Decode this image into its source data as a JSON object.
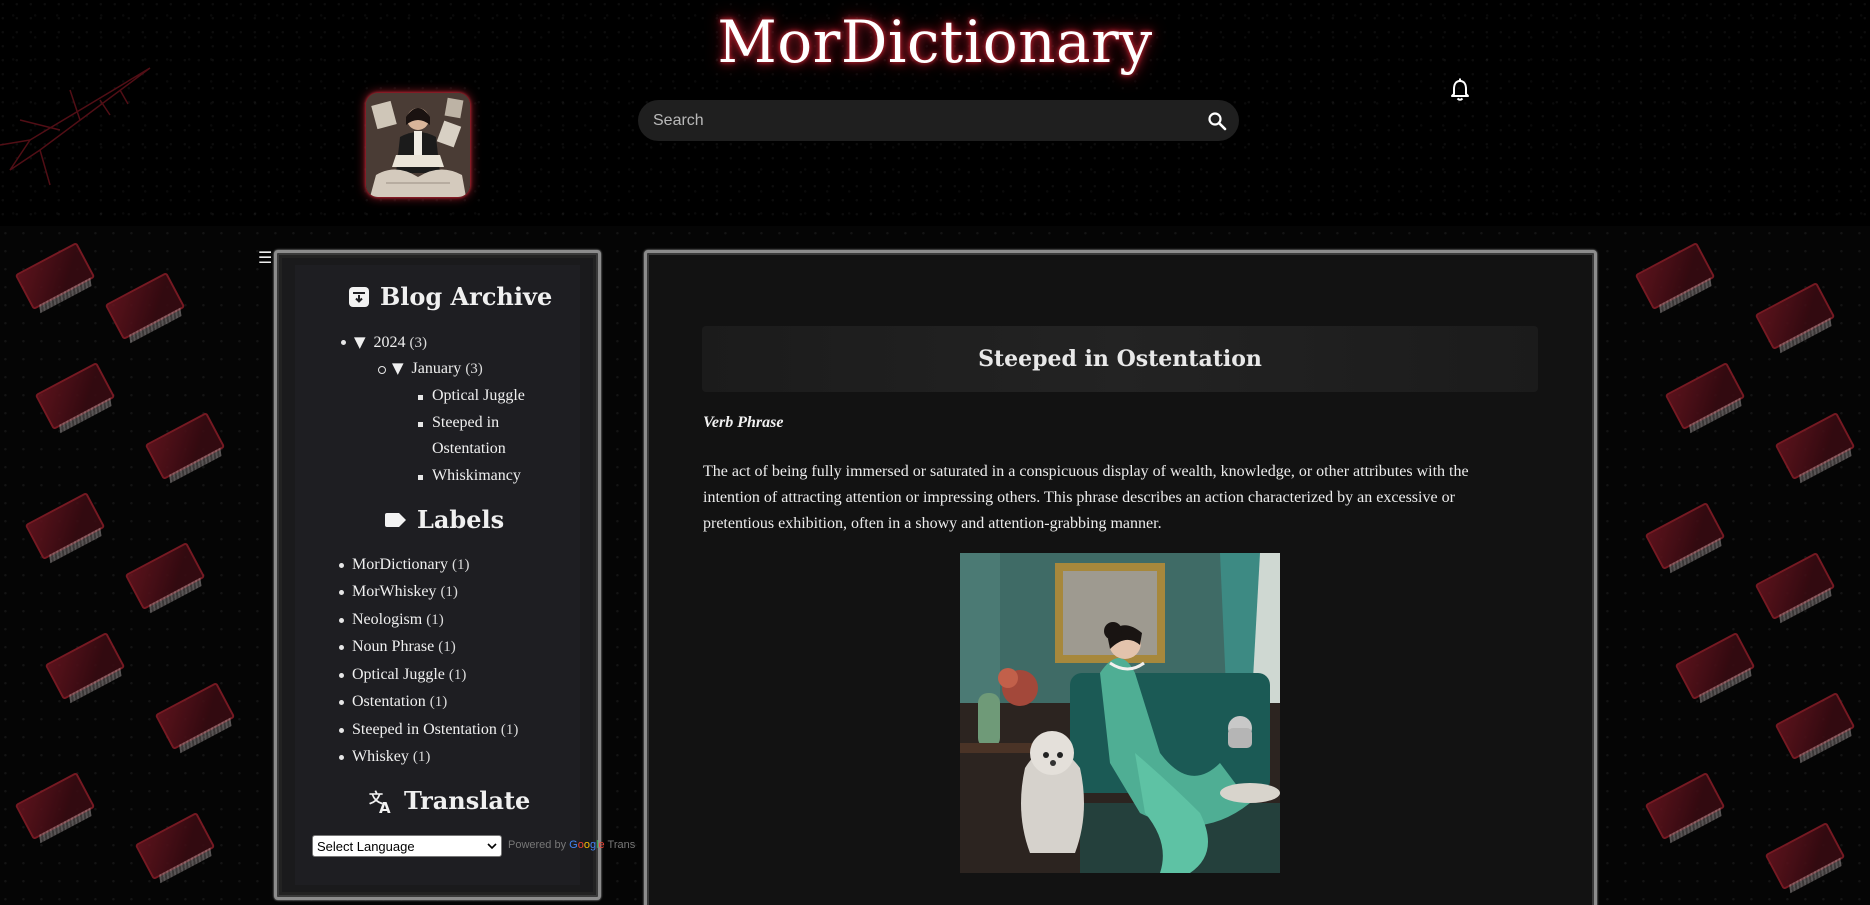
{
  "site": {
    "title": "MorDictionary"
  },
  "search": {
    "placeholder": "Search"
  },
  "icons": {
    "search": "search-icon",
    "bell": "bell-icon",
    "menu": "hamburger-menu-icon",
    "archive": "archive-icon",
    "labels": "label-tag-icon",
    "translate": "translate-icon"
  },
  "colors": {
    "glow": "#b0202e",
    "background": "#000000",
    "panel": "#1a1a1c"
  },
  "sidebar": {
    "menu_toggle": "☰",
    "archive": {
      "title": "Blog Archive",
      "year": {
        "label": "2024",
        "count": "(3)"
      },
      "month": {
        "label": "January",
        "count": "(3)"
      },
      "posts": [
        "Optical Juggle",
        "Steeped in",
        "Ostentation",
        "Whiskimancy"
      ]
    },
    "labels": {
      "title": "Labels",
      "items": [
        {
          "name": "MorDictionary",
          "count": "(1)"
        },
        {
          "name": "MorWhiskey",
          "count": "(1)"
        },
        {
          "name": "Neologism",
          "count": "(1)"
        },
        {
          "name": "Noun Phrase",
          "count": "(1)"
        },
        {
          "name": "Optical Juggle",
          "count": "(1)"
        },
        {
          "name": "Ostentation",
          "count": "(1)"
        },
        {
          "name": "Steeped in Ostentation",
          "count": "(1)"
        },
        {
          "name": "Whiskey",
          "count": "(1)"
        }
      ]
    },
    "translate": {
      "title": "Translate",
      "select_label": "Select Language",
      "powered_by": "Powered by",
      "google": [
        "G",
        "o",
        "o",
        "g",
        "l",
        "e"
      ],
      "translate_word": "Trans"
    }
  },
  "post": {
    "title": "Steeped in Ostentation",
    "type": "Verb Phrase",
    "body": "The act of being fully immersed or saturated in a conspicuous display of wealth, knowledge, or other attributes with the intention of attracting attention or impressing others. This phrase describes an action characterized by an excessive or pretentious exhibition, often in a showy and attention-grabbing manner."
  }
}
